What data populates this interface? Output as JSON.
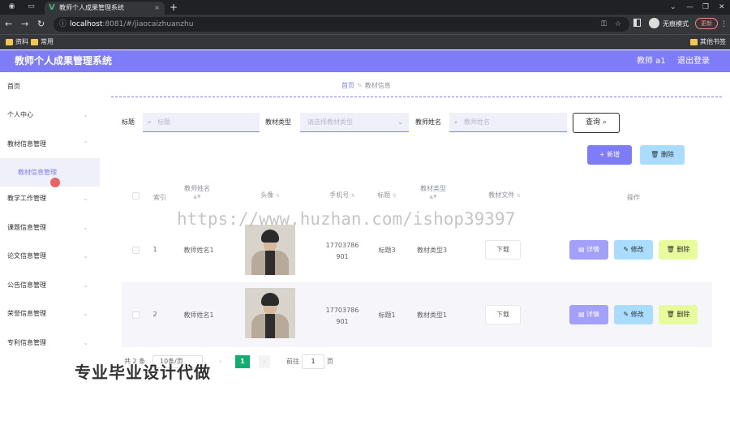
{
  "browser": {
    "tab_title": "教师个人成果管理系统",
    "url_host": "localhost",
    "url_path": ":8081/#/jiaocaizhuanzhu",
    "incognito_label": "无痕模式",
    "update_label": "更新",
    "bookmarks": [
      "资料",
      "常用"
    ],
    "other_bookmarks": "其他书签"
  },
  "header": {
    "title": "教师个人成果管理系统",
    "user": "教师 a1",
    "logout": "退出登录",
    "accent": "#7f7cfa"
  },
  "sidebar": {
    "items": [
      {
        "label": "首页"
      },
      {
        "label": "个人中心"
      },
      {
        "label": "教材信息管理"
      },
      {
        "label": "教材信息管理"
      },
      {
        "label": "教学工作管理"
      },
      {
        "label": "课题信息管理"
      },
      {
        "label": "论文信息管理"
      },
      {
        "label": "公告信息管理"
      },
      {
        "label": "荣誉信息管理"
      },
      {
        "label": "专利信息管理"
      }
    ]
  },
  "breadcrumb": {
    "home": "首页",
    "current": "教材信息"
  },
  "filters": {
    "title_label": "标题",
    "title_placeholder": "标题",
    "type_label": "教材类型",
    "type_placeholder": "请选择教材类型",
    "teacher_label": "教师姓名",
    "teacher_placeholder": "教师姓名",
    "query_button": "查询"
  },
  "toolbar": {
    "add": "新增",
    "delete": "删除"
  },
  "table": {
    "headers": {
      "index": "索引",
      "teacher": "教师姓名",
      "avatar": "头像",
      "phone": "手机号",
      "title": "标题",
      "type": "教材类型",
      "file": "教材文件",
      "actions": "操作"
    },
    "rows": [
      {
        "index": "1",
        "teacher": "教师姓名1",
        "phone_a": "17703786",
        "phone_b": "901",
        "title": "标题3",
        "type": "教材类型3",
        "download": "下载",
        "detail": "详情",
        "edit": "修改",
        "del": "删除"
      },
      {
        "index": "2",
        "teacher": "教师姓名1",
        "phone_a": "17703786",
        "phone_b": "901",
        "title": "标题1",
        "type": "教材类型1",
        "download": "下载",
        "detail": "详情",
        "edit": "修改",
        "del": "删除"
      }
    ]
  },
  "pagination": {
    "total": "共 2 条",
    "page_size": "10条/页",
    "current_page": "1",
    "goto_label": "前往",
    "goto_value": "1",
    "page_suffix": "页"
  },
  "overlays": {
    "watermark": "https://www.huzhan.com/ishop39397",
    "promo": "专业毕业设计代做"
  }
}
